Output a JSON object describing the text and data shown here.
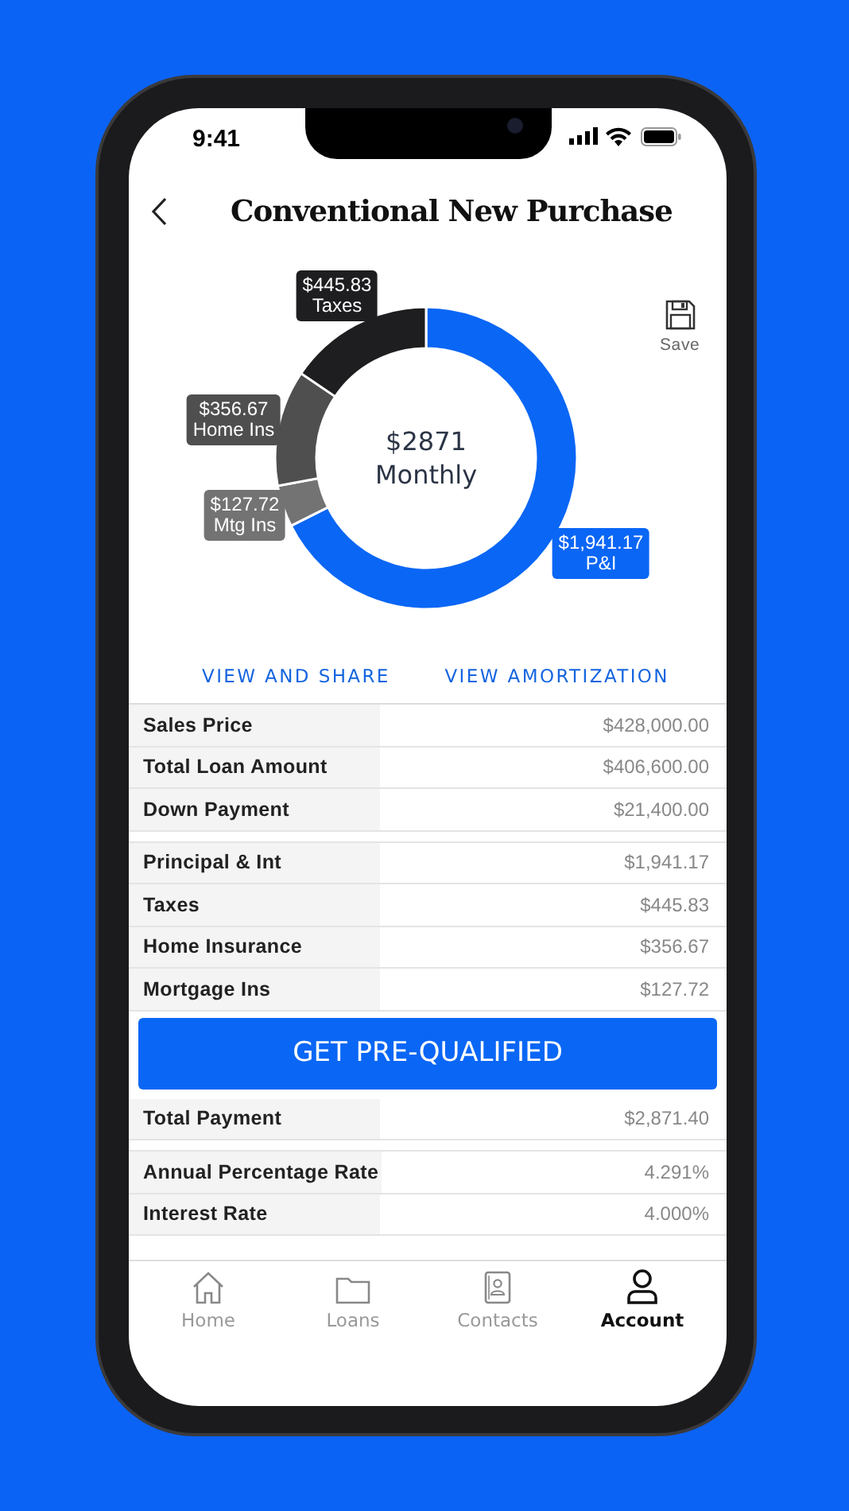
{
  "status_bar": {
    "time": "9:41"
  },
  "header": {
    "title": "Conventional New Purchase"
  },
  "save": {
    "label": "Save"
  },
  "chart": {
    "center_amount": "$2871",
    "center_label": "Monthly",
    "chart_data": {
      "type": "donut",
      "categories": [
        "P&I",
        "Mtg Ins",
        "Home Ins",
        "Taxes"
      ],
      "values": [
        1941.17,
        127.72,
        356.67,
        445.83
      ],
      "value_labels": [
        "$1,941.17",
        "$127.72",
        "$356.67",
        "$445.83"
      ],
      "colors": [
        "#0a66f5",
        "#737373",
        "#4f4f4f",
        "#1e1e20"
      ]
    }
  },
  "links": [
    "VIEW AND SHARE",
    "VIEW AMORTIZATION"
  ],
  "details": [
    {
      "kind": "row",
      "label": "Sales Price",
      "value": "$428,000.00"
    },
    {
      "kind": "row",
      "label": "Total Loan Amount",
      "value": "$406,600.00"
    },
    {
      "kind": "row",
      "label": "Down Payment",
      "value": "$21,400.00"
    },
    {
      "kind": "gap"
    },
    {
      "kind": "row",
      "label": "Principal & Int",
      "value": "$1,941.17"
    },
    {
      "kind": "row",
      "label": "Taxes",
      "value": "$445.83"
    },
    {
      "kind": "row",
      "label": "Home Insurance",
      "value": "$356.67"
    },
    {
      "kind": "row",
      "label": "Mortgage Ins",
      "value": "$127.72"
    },
    {
      "kind": "button",
      "label": "GET PRE-QUALIFIED"
    },
    {
      "kind": "row",
      "label": "Total Payment",
      "value": "$2,871.40"
    },
    {
      "kind": "gap"
    },
    {
      "kind": "row",
      "label": "Annual Percentage Rate",
      "value": "4.291%"
    },
    {
      "kind": "row",
      "label": "Interest Rate",
      "value": "4.000%"
    }
  ],
  "tab_bar": [
    {
      "label": "Home",
      "selected": false
    },
    {
      "label": "Loans",
      "selected": false
    },
    {
      "label": "Contacts",
      "selected": false
    },
    {
      "label": "Account",
      "selected": true
    }
  ]
}
